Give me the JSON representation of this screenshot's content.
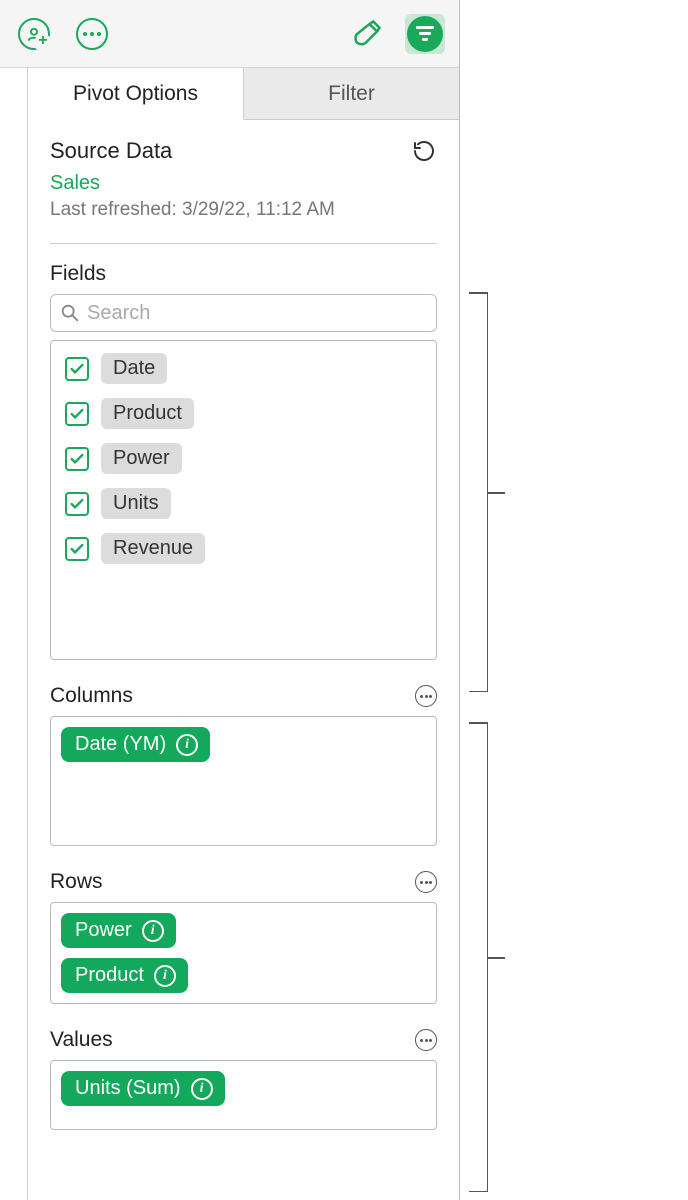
{
  "toolbar": {
    "collab_icon": "collab-add-icon",
    "more_icon": "more-icon",
    "format_icon": "format-brush-icon",
    "filter_icon": "filter-lines-icon"
  },
  "tabs": {
    "pivot": "Pivot Options",
    "filter": "Filter"
  },
  "source": {
    "heading": "Source Data",
    "name": "Sales",
    "refreshed": "Last refreshed: 3/29/22, 11:12 AM"
  },
  "fields": {
    "label": "Fields",
    "search_placeholder": "Search",
    "items": [
      {
        "label": "Date",
        "checked": true
      },
      {
        "label": "Product",
        "checked": true
      },
      {
        "label": "Power",
        "checked": true
      },
      {
        "label": "Units",
        "checked": true
      },
      {
        "label": "Revenue",
        "checked": true
      }
    ]
  },
  "columns": {
    "label": "Columns",
    "items": [
      {
        "label": "Date (YM)"
      }
    ]
  },
  "rows": {
    "label": "Rows",
    "items": [
      {
        "label": "Power"
      },
      {
        "label": "Product"
      }
    ]
  },
  "values": {
    "label": "Values",
    "items": [
      {
        "label": "Units (Sum)"
      }
    ]
  }
}
